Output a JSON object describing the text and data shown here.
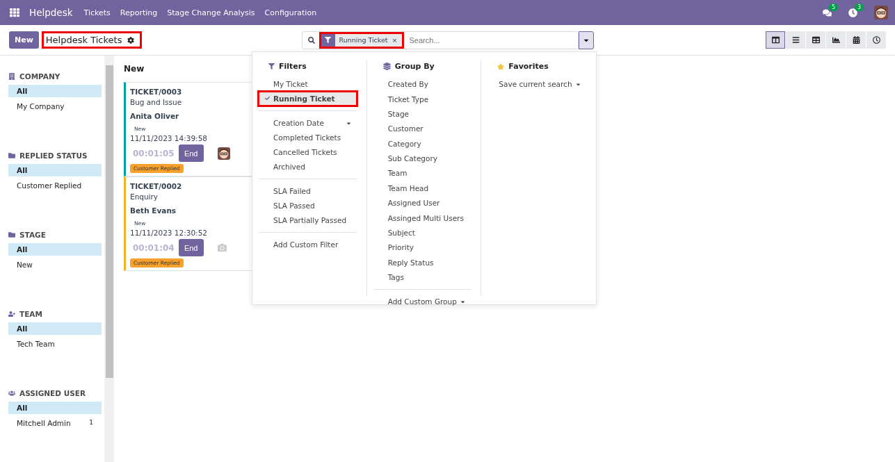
{
  "navbar": {
    "app_name": "Helpdesk",
    "menus": [
      "Tickets",
      "Reporting",
      "Stage Change Analysis",
      "Configuration"
    ],
    "messages_count": "5",
    "activities_count": "3"
  },
  "control_panel": {
    "new_button": "New",
    "breadcrumb": "Helpdesk Tickets",
    "breadcrumb_annotated": true,
    "facet": "Running Ticket",
    "facet_remove": "×",
    "facet_annotated": true,
    "search_placeholder": "Search...",
    "dropdown_open": true,
    "views": [
      {
        "kind": "kanban",
        "selected": true
      },
      {
        "kind": "list",
        "selected": false
      },
      {
        "kind": "pivot",
        "selected": false
      },
      {
        "kind": "graph",
        "selected": false
      },
      {
        "kind": "calendar",
        "selected": false
      },
      {
        "kind": "activity",
        "selected": false
      }
    ]
  },
  "sidebar": [
    {
      "title": "COMPANY",
      "items": [
        {
          "label": "All",
          "selected": true
        },
        {
          "label": "My Company",
          "selected": false
        }
      ]
    },
    {
      "title": "REPLIED STATUS",
      "items": [
        {
          "label": "All",
          "selected": true
        },
        {
          "label": "Customer Replied",
          "selected": false
        }
      ]
    },
    {
      "title": "STAGE",
      "items": [
        {
          "label": "All",
          "selected": true
        },
        {
          "label": "New",
          "selected": false
        }
      ]
    },
    {
      "title": "TEAM",
      "items": [
        {
          "label": "All",
          "selected": true
        },
        {
          "label": "Tech Team",
          "selected": false
        }
      ]
    },
    {
      "title": "ASSIGNED USER",
      "items": [
        {
          "label": "All",
          "selected": true
        },
        {
          "label": "Mitchell Admin",
          "selected": false,
          "count": "1"
        }
      ]
    }
  ],
  "kanban": {
    "column_title": "New",
    "cards": [
      {
        "reference": "TICKET/0003",
        "type": "Bug and Issue",
        "customer": "Anita Oliver",
        "stage": "New",
        "date": "11/11/2023 14:39:58",
        "timer": "00:01:05",
        "button": "End",
        "tag": "Customer Replied",
        "color": "#00a09d",
        "has_photo": true
      },
      {
        "reference": "TICKET/0002",
        "type": "Enquiry",
        "customer": "Beth Evans",
        "stage": "New",
        "date": "11/11/2023 12:30:52",
        "timer": "00:01:04",
        "button": "End",
        "tag": "Customer Replied",
        "color": "#f0b429",
        "has_photo": false
      }
    ]
  },
  "search_dropdown": {
    "filters_title": "Filters",
    "filter_groups": [
      [
        {
          "label": "My Ticket",
          "selected": false
        },
        {
          "label": "Running Ticket",
          "selected": true,
          "annotated": true
        }
      ],
      [
        {
          "label": "Creation Date",
          "selected": false,
          "has_submenu": true
        },
        {
          "label": "Completed Tickets",
          "selected": false
        },
        {
          "label": "Cancelled Tickets",
          "selected": false
        },
        {
          "label": "Archived",
          "selected": false
        }
      ],
      [
        {
          "label": "SLA Failed",
          "selected": false
        },
        {
          "label": "SLA Passed",
          "selected": false
        },
        {
          "label": "SLA Partially Passed",
          "selected": false
        }
      ],
      [
        {
          "label": "Add Custom Filter",
          "selected": false
        }
      ]
    ],
    "group_by_title": "Group By",
    "group_by": [
      "Created By",
      "Ticket Type",
      "Stage",
      "Customer",
      "Category",
      "Sub Category",
      "Team",
      "Team Head",
      "Assigned User",
      "Assinged Multi Users",
      "Subject",
      "Priority",
      "Reply Status",
      "Tags"
    ],
    "add_custom_group": "Add Custom Group",
    "favorites_title": "Favorites",
    "save_search": "Save current search"
  }
}
